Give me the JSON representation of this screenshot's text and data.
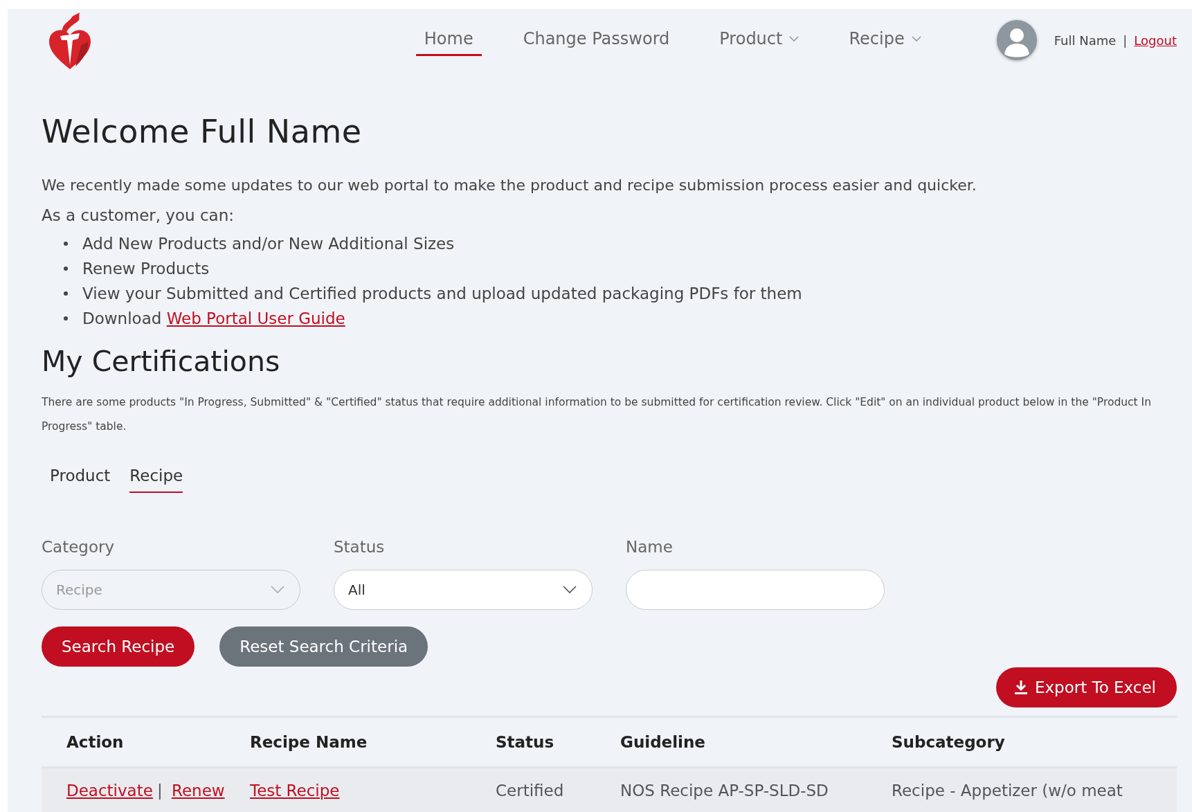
{
  "nav": {
    "items": [
      {
        "label": "Home",
        "selected": true,
        "dropdown": false
      },
      {
        "label": "Change Password",
        "selected": false,
        "dropdown": false
      },
      {
        "label": "Product",
        "selected": false,
        "dropdown": true
      },
      {
        "label": "Recipe",
        "selected": false,
        "dropdown": true
      }
    ],
    "user_name": "Full Name",
    "separator": "|",
    "logout": "Logout"
  },
  "title": "Welcome Full Name",
  "intro": "We recently made some updates to our web portal to make the product and recipe submission process easier and quicker.",
  "list_intro": "As a customer, you can:",
  "bullets": [
    {
      "text": "Add New Products and/or New Additional Sizes"
    },
    {
      "text": "Renew Products"
    },
    {
      "text": "View your Submitted and Certified products and upload updated packaging PDFs for them"
    },
    {
      "text": "Download ",
      "link": "Web Portal User Guide"
    }
  ],
  "section_title": "My Certifications",
  "notice": "There are some products \"In Progress, Submitted\" & \"Certified\" status that require additional information to be submitted for certification review. Click \"Edit\" on an individual product below in the \"Product In Progress\" table.",
  "tabs": [
    {
      "label": "Product",
      "selected": false
    },
    {
      "label": "Recipe",
      "selected": true
    }
  ],
  "filters": [
    {
      "kind": "select",
      "label": "Category",
      "value": "Recipe",
      "disabled": true
    },
    {
      "kind": "select",
      "label": "Status",
      "value": "All",
      "disabled": false
    },
    {
      "kind": "text",
      "label": "Name"
    }
  ],
  "buttons": [
    {
      "label": "Search Recipe",
      "kind": "primary"
    },
    {
      "label": "Reset Search Criteria",
      "kind": "secondary"
    }
  ],
  "export_button": "Export To Excel",
  "table": {
    "columns": [
      "Action",
      "Recipe Name",
      "Status",
      "Guideline",
      "Subcategory"
    ],
    "rows": [
      {
        "actions": [
          "Deactivate",
          "Renew"
        ],
        "action_separator": "|",
        "name": "Test Recipe",
        "status": "Certified",
        "guideline": "NOS Recipe AP-SP-SLD-SD",
        "subcategory": "Recipe - Appetizer (w/o meat"
      }
    ]
  }
}
